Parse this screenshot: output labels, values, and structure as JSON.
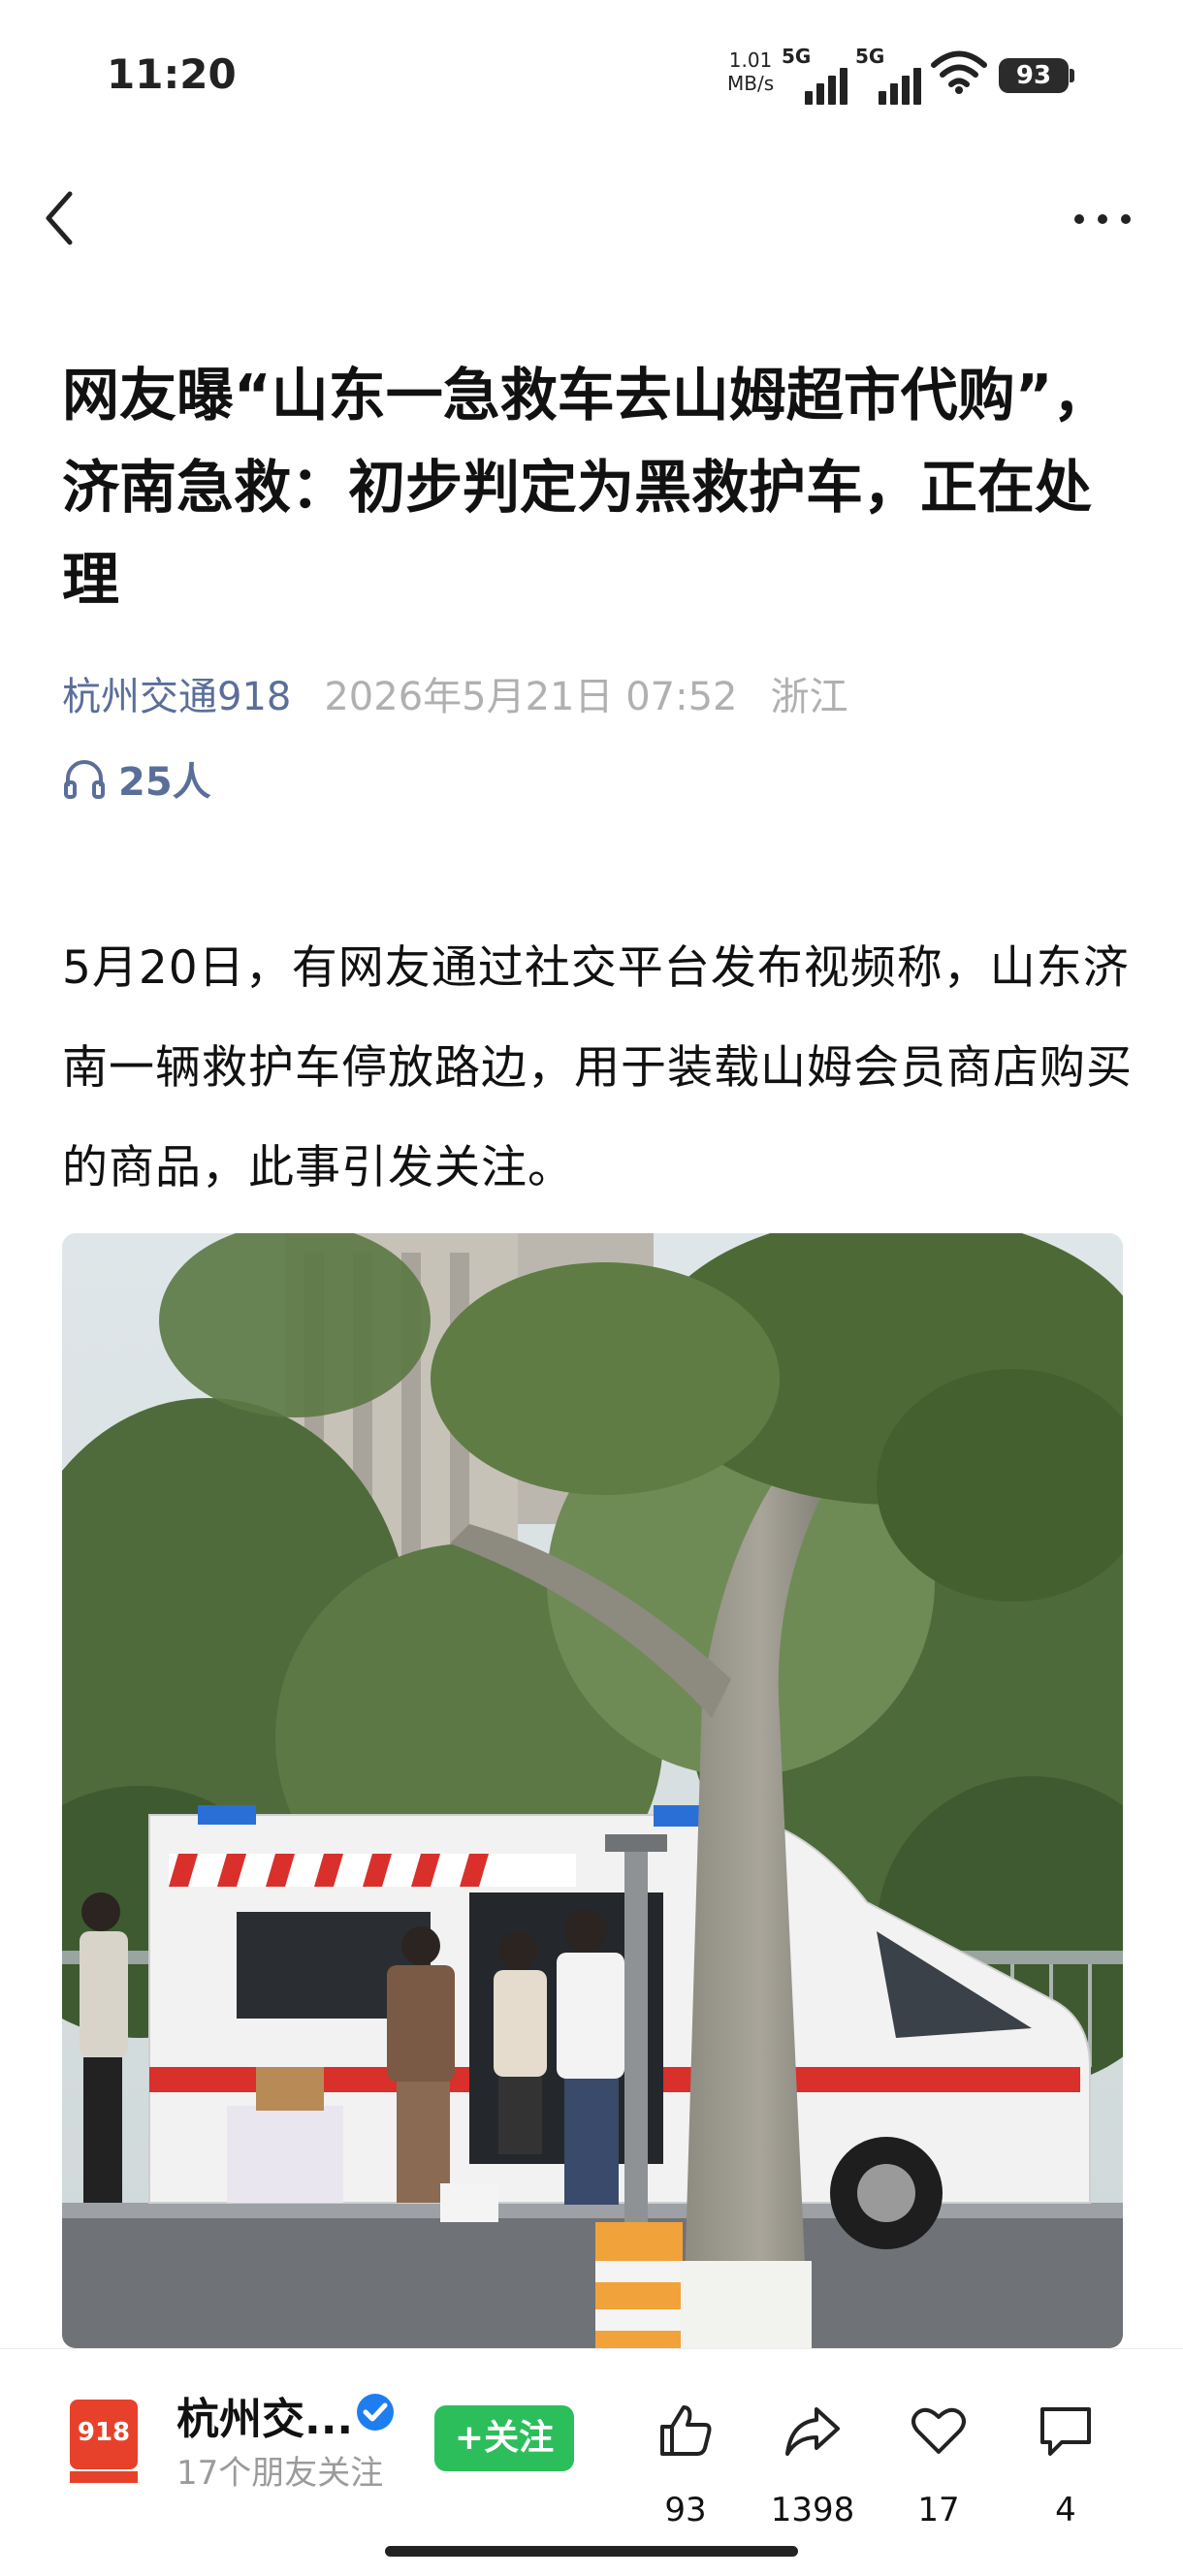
{
  "status": {
    "time": "11:20",
    "net_speed_value": "1.01",
    "net_speed_unit": "MB/s",
    "signal1": "5G",
    "signal2": "5G",
    "battery": "93"
  },
  "article": {
    "title": "网友曝“山东一急救车去山姆超市代购”，济南急救：初步判定为黑救护车，正在处理",
    "source": "杭州交通918",
    "date": "2026年5月21日 07:52",
    "location": "浙江",
    "listeners": "25人",
    "body": "5月20日，有网友通过社交平台发布视频称，山东济南一辆救护车停放路边，用于装载山姆会员商店购买的商品，此事引发关注。"
  },
  "bottom_bar": {
    "account_name": "杭州交...",
    "followers": "17个朋友关注",
    "follow_label": "+关注",
    "likes": "93",
    "shares": "1398",
    "favorites": "17",
    "comments": "4"
  },
  "colors": {
    "accent_blue": "#5a6e9a",
    "follow_green": "#2dbe5c",
    "verified_blue": "#1e7ef0"
  },
  "icons": [
    "back-icon",
    "more-icon",
    "headphone-icon",
    "verified-icon",
    "like-icon",
    "share-icon",
    "favorite-icon",
    "comment-icon",
    "wifi-icon",
    "signal-icon",
    "battery-icon"
  ]
}
